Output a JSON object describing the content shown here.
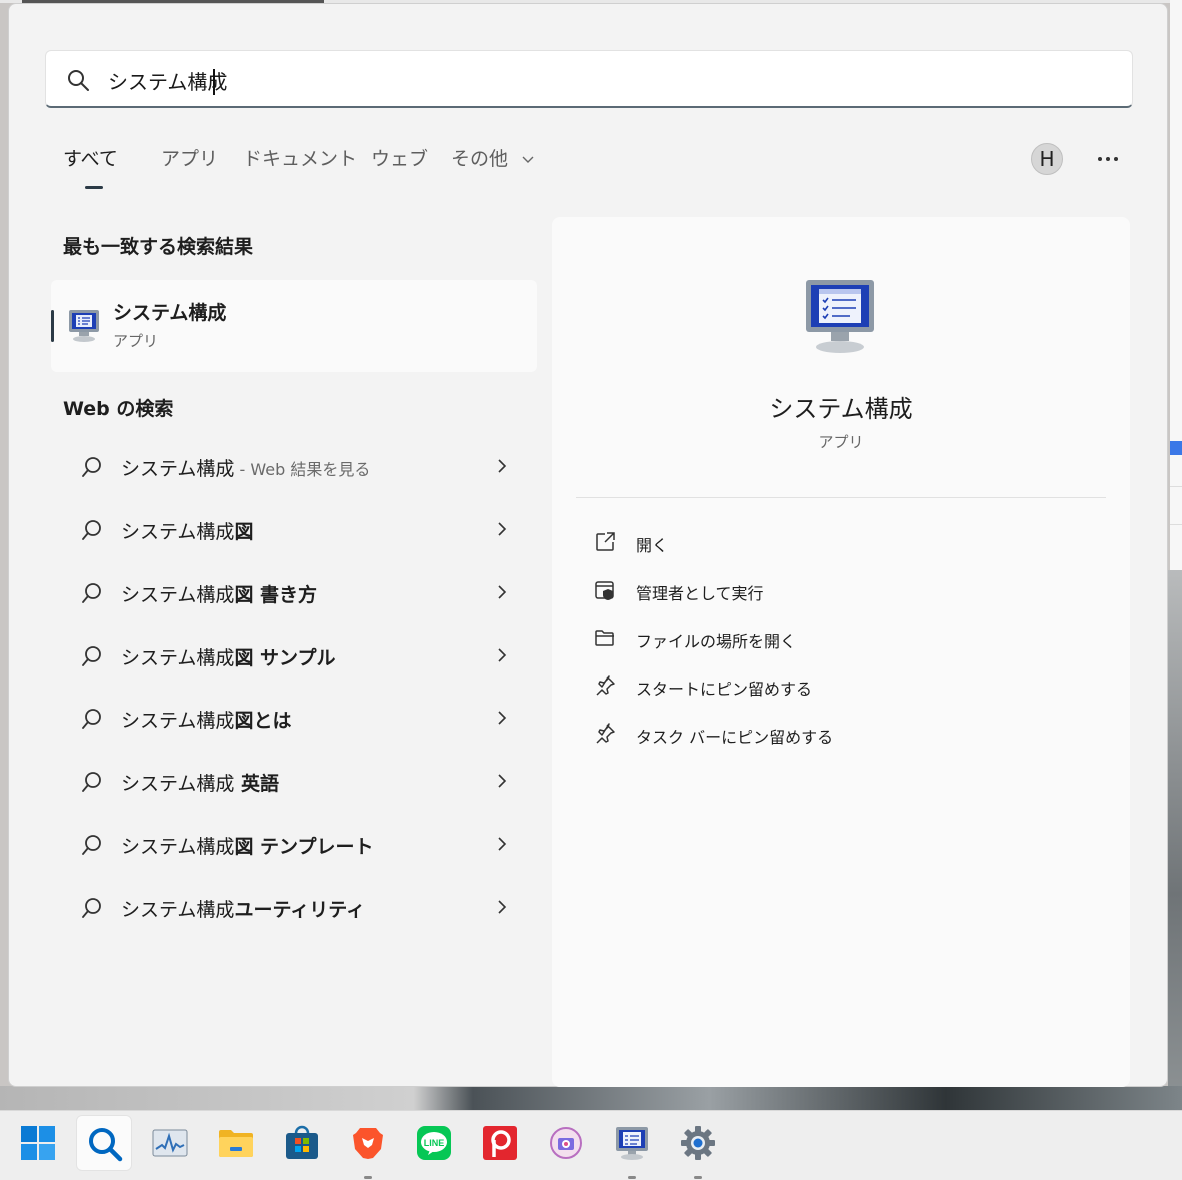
{
  "search": {
    "value": "システム構成",
    "icon": "search-icon"
  },
  "tabs": [
    {
      "label": "すべて",
      "active": true
    },
    {
      "label": "アプリ"
    },
    {
      "label": "ドキュメント"
    },
    {
      "label": "ウェブ"
    },
    {
      "label": "その他"
    }
  ],
  "account": {
    "initial": "H"
  },
  "best_match": {
    "heading": "最も一致する検索結果",
    "name": "システム構成",
    "type": "アプリ"
  },
  "web": {
    "heading": "Web の検索",
    "items": [
      {
        "normal": "システム構成",
        "bold": "",
        "sub": " - Web 結果を見る"
      },
      {
        "normal": "システム構成",
        "bold": "図",
        "sub": ""
      },
      {
        "normal": "システム構成",
        "bold": "図 書き方",
        "sub": ""
      },
      {
        "normal": "システム構成",
        "bold": "図 サンプル",
        "sub": ""
      },
      {
        "normal": "システム構成",
        "bold": "図とは",
        "sub": ""
      },
      {
        "normal": "システム構成",
        "bold": " 英語",
        "sub": ""
      },
      {
        "normal": "システム構成",
        "bold": "図 テンプレート",
        "sub": ""
      },
      {
        "normal": "システム構成",
        "bold": "ユーティリティ",
        "sub": ""
      }
    ]
  },
  "preview": {
    "name": "システム構成",
    "type": "アプリ",
    "actions": [
      {
        "label": "開く",
        "icon": "open-external-icon"
      },
      {
        "label": "管理者として実行",
        "icon": "admin-shield-icon"
      },
      {
        "label": "ファイルの場所を開く",
        "icon": "folder-icon"
      },
      {
        "label": "スタートにピン留めする",
        "icon": "pin-icon"
      },
      {
        "label": "タスク バーにピン留めする",
        "icon": "pin-icon"
      }
    ]
  },
  "taskbar": [
    {
      "icon": "windows-start-icon"
    },
    {
      "icon": "search-icon",
      "active": true
    },
    {
      "icon": "task-manager-icon"
    },
    {
      "icon": "file-explorer-icon"
    },
    {
      "icon": "microsoft-store-icon"
    },
    {
      "icon": "brave-browser-icon",
      "running": true
    },
    {
      "icon": "line-app-icon"
    },
    {
      "icon": "p-app-icon"
    },
    {
      "icon": "camera-app-icon"
    },
    {
      "icon": "system-configuration-icon",
      "running": true
    },
    {
      "icon": "settings-gear-icon",
      "running": true
    }
  ],
  "colors": {
    "accent": "#2b3a46",
    "line_green": "#06c755",
    "brave_orange": "#fb542b",
    "blue": "#0067c0"
  }
}
